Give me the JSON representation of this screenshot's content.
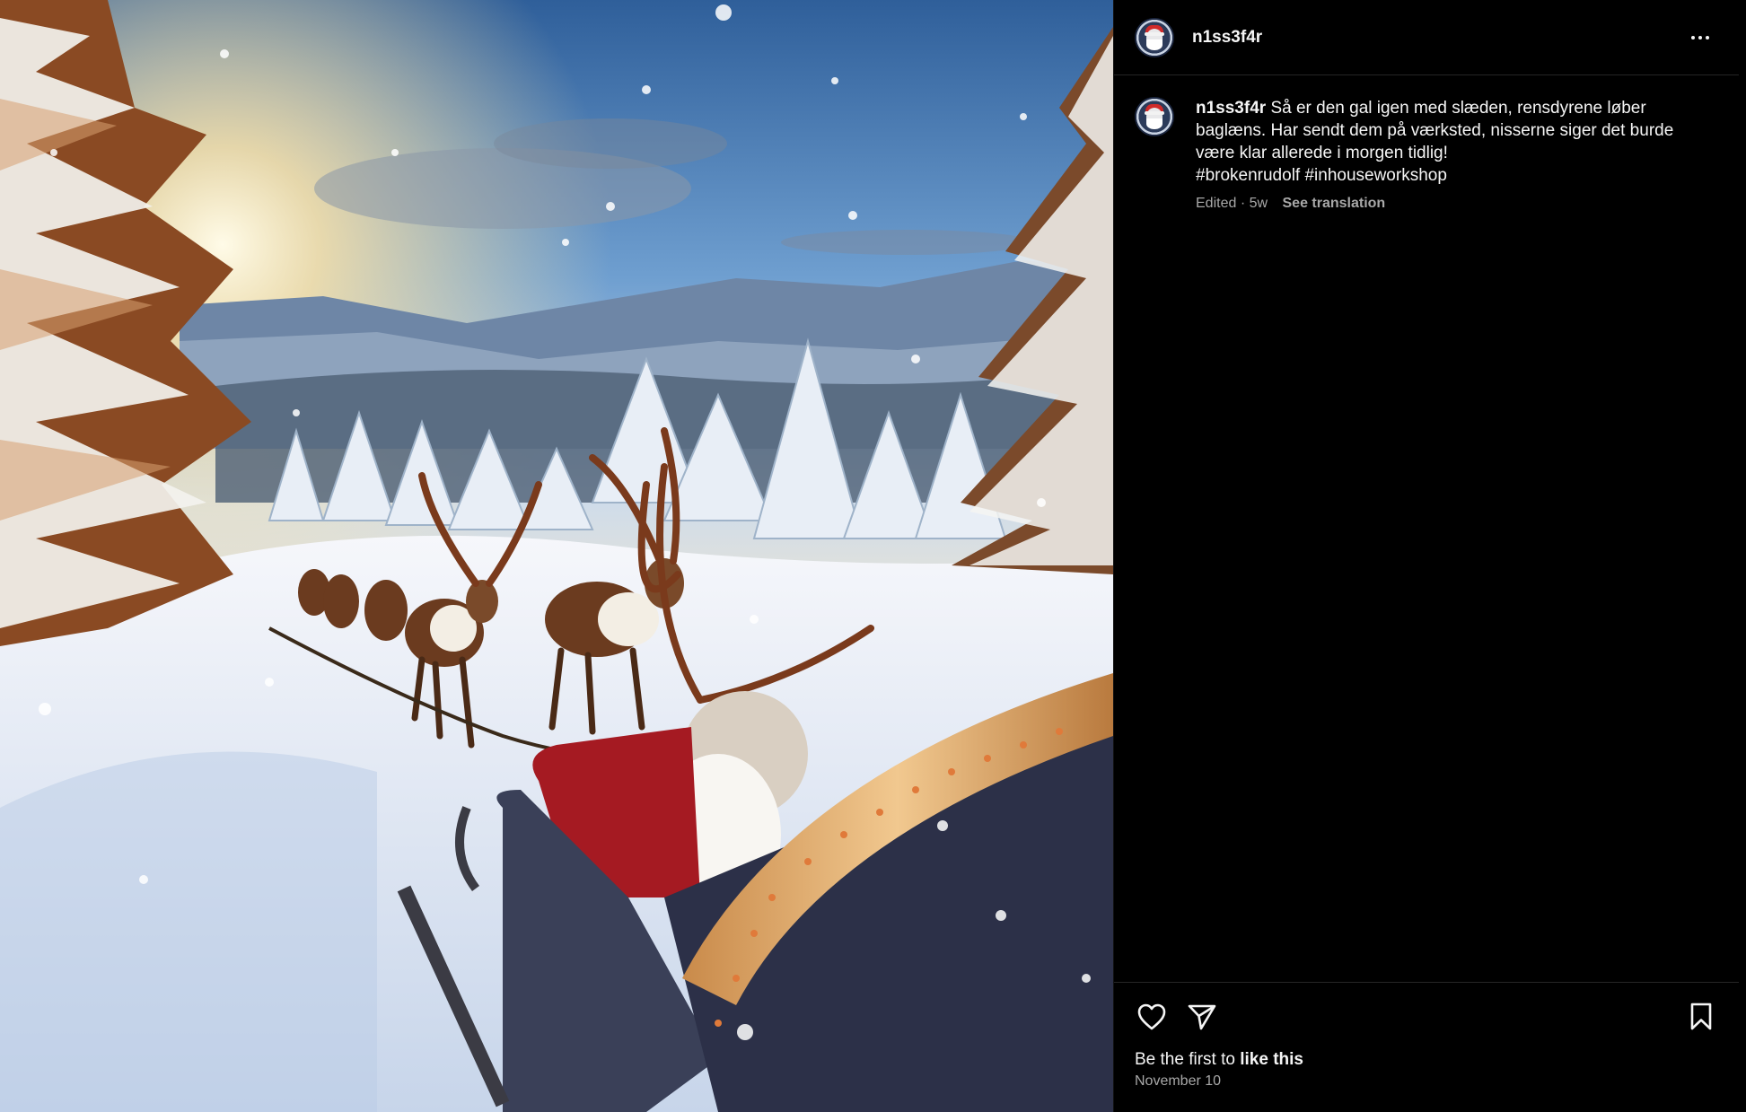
{
  "post": {
    "image_alt": "Reindeer pulling a sleigh through a snowy forest at sunrise",
    "image_icon": "photo-scene"
  },
  "header": {
    "username": "n1ss3f4r",
    "more_icon": "more-horizontal-icon"
  },
  "caption": {
    "username": "n1ss3f4r",
    "text": "Så er den gal igen med slæden, rensdyrene løber baglæns. Har sendt dem på værksted, nisserne siger det burde være klar allerede i morgen tidlig!",
    "hashtags": "#brokenrudolf #inhouseworkshop",
    "edited": "Edited · 5w",
    "see_translation": "See translation"
  },
  "actions": {
    "like_icon": "heart-icon",
    "share_icon": "send-icon",
    "save_icon": "bookmark-icon"
  },
  "likes": {
    "prefix": "Be the first to ",
    "link": "like this"
  },
  "date": "November 10",
  "colors": {
    "background": "#000000",
    "text": "#f5f5f5",
    "muted": "#a8a8a8",
    "divider": "#262626"
  }
}
